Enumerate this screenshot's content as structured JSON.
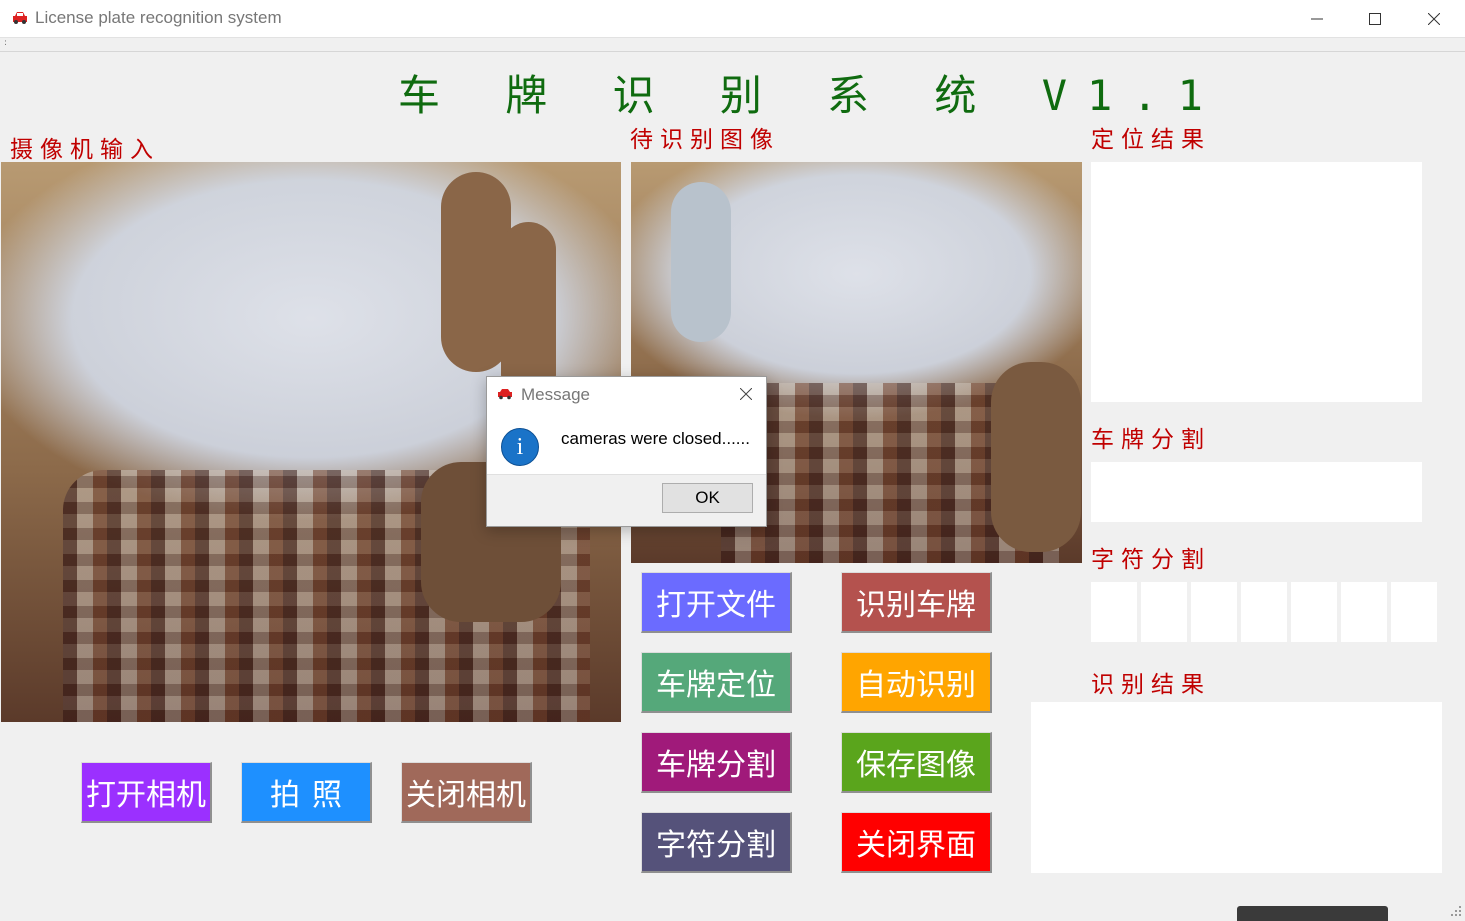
{
  "window": {
    "title": "License plate recognition system",
    "icon": "car-icon",
    "controls": [
      "minimize-icon",
      "maximize-icon",
      "close-icon"
    ]
  },
  "app": {
    "main_title": "车 牌 识 别 系 统 V1.1"
  },
  "sections": {
    "camera_input": "摄像机输入",
    "pending_image": "待识别图像",
    "locate_result": "定位结果",
    "plate_segmentation": "车牌分割",
    "char_segmentation": "字符分割",
    "recognition_result": "识别结果"
  },
  "buttons": {
    "open_camera": "打开相机",
    "take_photo": "拍照",
    "close_camera": "关闭相机",
    "open_file": "打开文件",
    "recognize_plate": "识别车牌",
    "locate_plate": "车牌定位",
    "auto_recognize": "自动识别",
    "segment_plate": "车牌分割",
    "save_image": "保存图像",
    "char_segment": "字符分割",
    "close_ui": "关闭界面"
  },
  "dialog": {
    "title": "Message",
    "icon": "info-icon",
    "info_glyph": "i",
    "message": "cameras were closed......",
    "ok_label": "OK"
  },
  "colors": {
    "title_green": "#0f6b0f",
    "section_red": "#c00000"
  }
}
